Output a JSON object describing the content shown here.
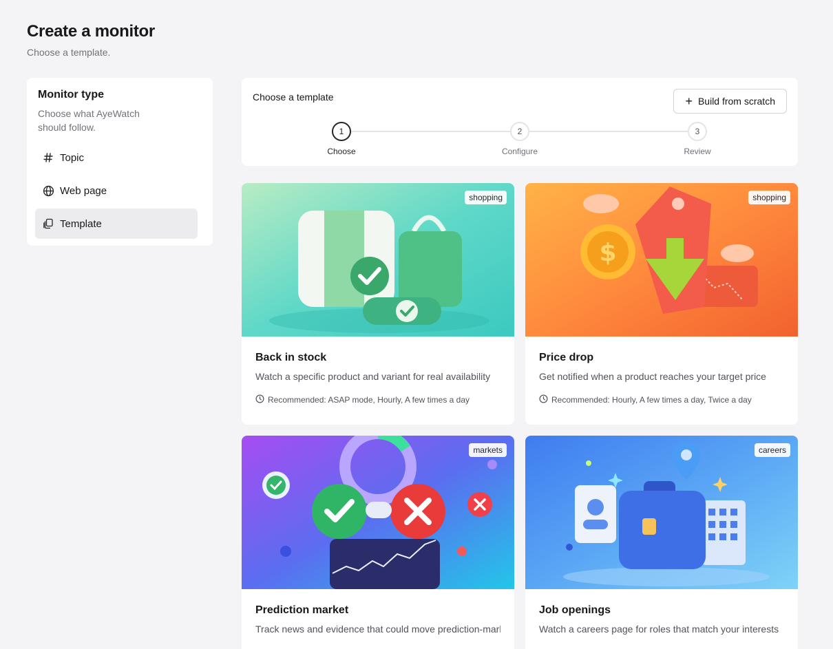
{
  "header": {
    "title": "Create a monitor",
    "subtitle": "Choose a template."
  },
  "sidebar": {
    "title": "Monitor type",
    "description": "Choose what AyeWatch should follow.",
    "items": [
      {
        "label": "Topic",
        "icon": "hash-icon",
        "active": false
      },
      {
        "label": "Web page",
        "icon": "globe-icon",
        "active": false
      },
      {
        "label": "Template",
        "icon": "copy-icon",
        "active": true
      }
    ]
  },
  "stepper": {
    "title": "Choose a template",
    "build_button_label": "Build from scratch",
    "steps": [
      {
        "number": "1",
        "label": "Choose",
        "active": true
      },
      {
        "number": "2",
        "label": "Configure",
        "active": false
      },
      {
        "number": "3",
        "label": "Review",
        "active": false
      }
    ]
  },
  "cards": [
    {
      "title": "Back in stock",
      "tag": "shopping",
      "description": "Watch a specific product and variant for real availability",
      "recommended": "Recommended: ASAP mode, Hourly, A few times a day",
      "image": "back-in-stock-illustration"
    },
    {
      "title": "Price drop",
      "tag": "shopping",
      "description": "Get notified when a product reaches your target price",
      "recommended": "Recommended: Hourly, A few times a day, Twice a day",
      "image": "price-drop-illustration"
    },
    {
      "title": "Prediction market",
      "tag": "markets",
      "description": "Track news and evidence that could move prediction-market odds",
      "recommended": "",
      "image": "prediction-market-illustration"
    },
    {
      "title": "Job openings",
      "tag": "careers",
      "description": "Watch a careers page for roles that match your interests",
      "recommended": "",
      "image": "job-openings-illustration"
    }
  ],
  "colors": {
    "background": "#f4f4f6",
    "surface": "#ffffff",
    "active_item": "#ececee",
    "text_primary": "#18181b",
    "text_muted": "#71717a"
  }
}
